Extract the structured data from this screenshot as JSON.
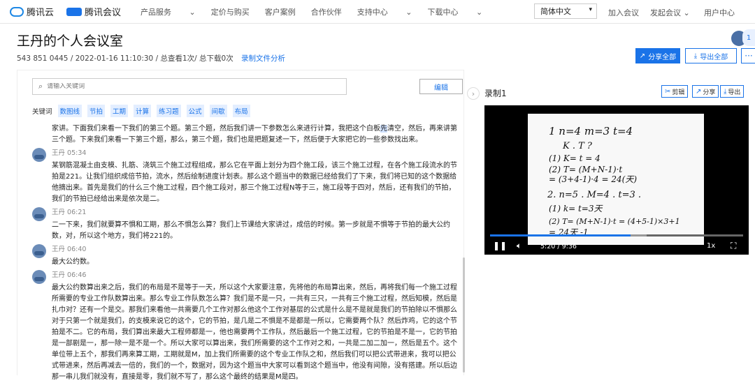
{
  "topbar": {
    "brand1": "腾讯云",
    "brand2": "腾讯会议",
    "nav": [
      "产品服务",
      "定价与购买",
      "客户案例",
      "合作伙伴",
      "支持中心",
      "下载中心"
    ],
    "language": "简体中文",
    "join": "加入会议",
    "host": "发起会议",
    "user_center": "用户中心"
  },
  "page": {
    "title": "王丹的个人会议室",
    "meeting_id": "543 851 0445",
    "datetime": "/ 2022-01-16 11:10:30",
    "stats": "/ 总查看1次/ 总下载0次",
    "analysis_link": "录制文件分析",
    "share_all": "分享全部",
    "export_all": "导出全部",
    "more": "···",
    "badge": "1"
  },
  "search": {
    "placeholder": "请输入关键词"
  },
  "edit_label": "编辑",
  "keywords_label": "关键词",
  "keywords": [
    "数图线",
    "节拍",
    "工期",
    "计算",
    "练习题",
    "公式",
    "间歇",
    "布局"
  ],
  "transcript": {
    "intro_before": "家讲。下面我们来看一下我们的第三个题。第三个题，然后我们讲一下参数怎么来进行计算，我把这个白板",
    "intro_highlight": "先",
    "intro_after": "清空，然后，再来讲第三个题。下来我们来看一下第三个题，那么，第三个题，我们也是把题复述一下，然后便于大家把它的一些参数找出来。",
    "entries": [
      {
        "speaker": "王丹",
        "time": "05:34",
        "text": "某钢筋混凝土由支模、扎筋、浇筑三个施工过程组成，那么它在平面上划分为四个施工段，该三个施工过程，在各个施工段流水的节拍是221。让我们组织成倍节拍，流水，然后绘制进度计划表。那么这个题当中的数据已经给我们了下来，我们将已知的这个数据给他摘出来。首先是我们的什么三个施工过程，四个施工段对，那三个施工过程N等于三，施工段等于四对，然后，还有我们的节拍，我们的节拍已经给出来是依次是二。"
      },
      {
        "speaker": "王丹",
        "time": "06:21",
        "text": "二一下来，我们就要算不惧和工期，那么不惧怎么算？我们上节课给大家讲过，成倍的时候。第一步就是不惧等于节拍的最大公约数，对，所以这个地方，我们将221的。"
      },
      {
        "speaker": "王丹",
        "time": "06:40",
        "text": "最大公约数。"
      },
      {
        "speaker": "王丹",
        "time": "06:46",
        "text": "最大公约数算出来之后，我们的布局是不是等于一天，所以这个大家要注意，先将他的布局算出来，然后，再将我们每一个施工过程所需要的专业工作队数算出来。那么专业工作队数怎么算？我们是不是一只，一共有三只，一共有三个施工过程，然后知模，然后是扎巾对？还有一个是交。那我们来看他一共需要几个工作对那么他这个工作对基层的公式是什么是不是就是我们的节拍除以不惧那么对于只第一个就是我们，的支模来说它的这个，它的节拍，是几是二不惧是不是都是一所以，它需要两个队？然后炸鸡，它的这个节拍是不二。它的布局，我们算出来最大工程师都是一，他也需要两个工作队，然后最后一个施工过程，它的节拍是不是一，它的节拍是一部剧是一，那一除一是不是一个。所以大家可以算出来，我们所需要的这个工作对之和，一共是二加二加一，然后是五个。这个单位带上五个，那我们再来算工期，工期就是M，加上我们所需要的这个专业工作队之和，然后我们可以把公式带进来，我可以把公式带进来，然后再减去一倍的，我们的一个，数据对，因为这个题当中大家可以看到这个题当中，他没有间隙，没有搭建。所以后边那一串儿我们就没有，直接是零，我们就不写了，那么这个最终的结果是M是四。"
      }
    ]
  },
  "recording": {
    "title": "录制1",
    "clip": "剪辑",
    "share": "分享",
    "export": "导出",
    "time_display": "5:20 / 9:36",
    "speed": "1x",
    "progress": 0.5556,
    "buffer_start": 0.55,
    "buffer_end": 0.62
  },
  "whiteboard_lines": [
    "1  n=4   m=3   t=4",
    "K . T ?",
    "(1)   K= t = 4",
    "(2)   T= (M+N-1)·t",
    "       = (3+4-1)·4 = 24(天)",
    "2.  n=5 .  M=4 .  t=3 .",
    "(1)  k= t=3天",
    "(2)  T= (M+N-1)·t = (4+5-1)×3+1",
    "        = 24天      -1"
  ]
}
